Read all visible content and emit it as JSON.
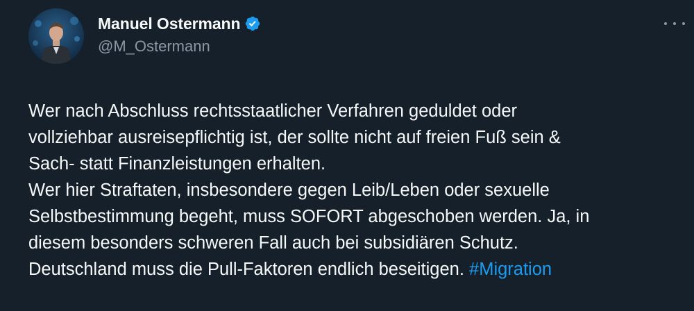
{
  "author": {
    "display_name": "Manuel Ostermann",
    "handle": "@M_Ostermann",
    "verified": true
  },
  "tweet": {
    "lines": [
      "Wer nach Abschluss rechtsstaatlicher Verfahren geduldet oder",
      "vollziehbar ausreisepflichtig ist, der sollte nicht auf freien Fuß sein &",
      "Sach- statt Finanzleistungen erhalten.",
      "Wer hier Straftaten, insbesondere gegen Leib/Leben oder sexuelle",
      "Selbstbestimmung begeht, muss SOFORT abgeschoben werden. Ja, in",
      "diesem besonders schweren Fall auch bei subsidiären Schutz."
    ],
    "last_line": "Deutschland muss die Pull-Faktoren endlich beseitigen. ",
    "hashtag": "#Migration"
  },
  "colors": {
    "background": "#15202b",
    "text": "#f7f9f9",
    "secondary": "#8b98a5",
    "accent": "#1d9bf0"
  },
  "icons": {
    "verified": "verified-badge-icon",
    "more": "more-options-icon"
  }
}
